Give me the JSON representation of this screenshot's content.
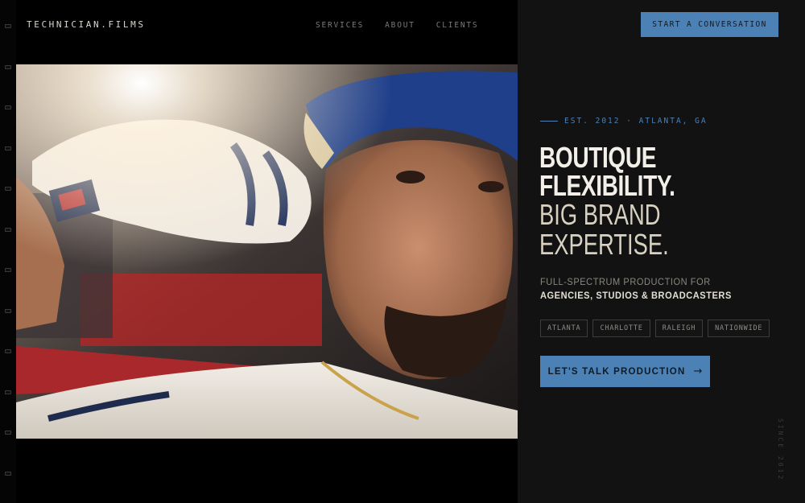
{
  "header": {
    "logo": "TECHNICIAN.FILMS",
    "nav": [
      "SERVICES",
      "ABOUT",
      "CLIENTS"
    ],
    "cta": "START A CONVERSATION"
  },
  "hero": {
    "eyebrow": "EST. 2012 · ATLANTA, GA",
    "headline_bold": [
      "BOUTIQUE",
      "FLEXIBILITY."
    ],
    "headline_light": [
      "BIG BRAND",
      "EXPERTISE."
    ],
    "subline_1": "FULL-SPECTRUM PRODUCTION FOR",
    "subline_2": "AGENCIES, STUDIOS & BROADCASTERS",
    "locations": [
      "ATLANTA",
      "CHARLOTTE",
      "RALEIGH",
      "NATIONWIDE"
    ],
    "cta_label": "LET'S TALK PRODUCTION",
    "cta_icon": "arrow-right-icon",
    "side_text": "SINCE 2012"
  },
  "colors": {
    "accent": "#4b81b5",
    "background": "#121212",
    "stage": "#000000"
  }
}
